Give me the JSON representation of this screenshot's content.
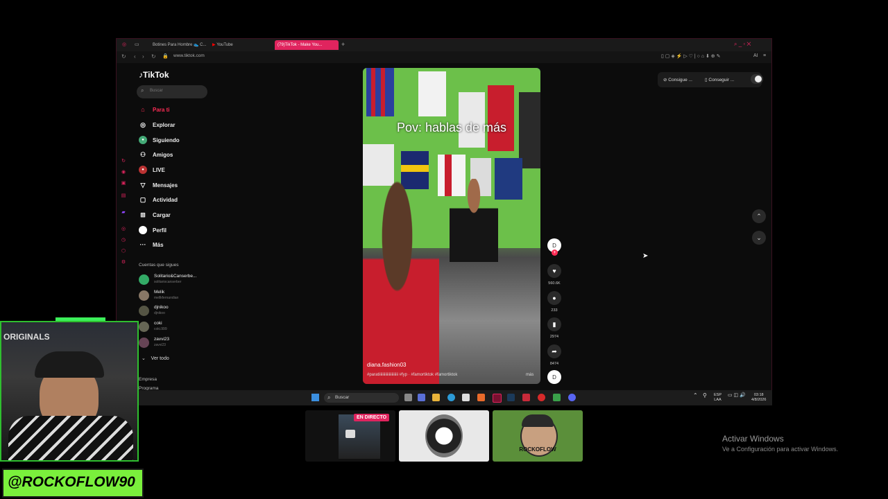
{
  "browser": {
    "tabs": [
      {
        "label": "Botines Para Hombre 👟 C..."
      },
      {
        "label": "YouTube"
      },
      {
        "label": "(79)TikTok - Make You..."
      }
    ],
    "new_tab": "+",
    "url": "www.tiktok.com",
    "toolbar_right": "AI"
  },
  "tiktok": {
    "logo": "TikTok",
    "search_placeholder": "Buscar",
    "nav": [
      {
        "label": "Para ti",
        "icon": "home-icon"
      },
      {
        "label": "Explorar",
        "icon": "compass-icon"
      },
      {
        "label": "Siguiendo",
        "icon": "following-avatar-icon"
      },
      {
        "label": "Amigos",
        "icon": "friends-icon"
      },
      {
        "label": "LIVE",
        "icon": "live-icon"
      },
      {
        "label": "Mensajes",
        "icon": "message-icon"
      },
      {
        "label": "Actividad",
        "icon": "activity-icon"
      },
      {
        "label": "Cargar",
        "icon": "upload-icon"
      },
      {
        "label": "Perfil",
        "icon": "profile-icon"
      },
      {
        "label": "Más",
        "icon": "more-icon"
      }
    ],
    "following_title": "Cuentas que sigues",
    "following": [
      {
        "name": "Solitario&Canserbe...",
        "handle": "solitariocanserber"
      },
      {
        "name": "Melik",
        "handle": "mellkfernandian"
      },
      {
        "name": "djnikoo",
        "handle": "djnikoo"
      },
      {
        "name": "coki",
        "handle": "coki.999"
      },
      {
        "name": "zavvi23",
        "handle": "zavvi23"
      }
    ],
    "see_all": "Ver todo",
    "footer_links": [
      "Empresa",
      "Programa"
    ],
    "video": {
      "caption": "Pov: hablas de más",
      "username": "diana.fashion03",
      "hashtags": "#paratiiiiiiiiiiiiiiiiiiiii #fyp · #famortiktok #famortiktok",
      "more": "más"
    },
    "actions": {
      "likes": "560.6K",
      "comments": "233",
      "saves": "2974",
      "shares": "8474"
    },
    "top_right": {
      "get_app1": "Consigue ...",
      "get_app2": "Conseguir ..."
    }
  },
  "taskbar": {
    "search_label": "Buscar",
    "lang_top": "ESP",
    "lang_bottom": "LAA",
    "time": "03:18",
    "date": "4/8/2026"
  },
  "stream": {
    "webcam_label": "ORIGINALS",
    "handle": "@ROCKOFLOW90",
    "live_badge": "EN DIRECTO",
    "thumb3_label": "ROCKOFLOW"
  },
  "windows_watermark": {
    "line1": "Activar Windows",
    "line2": "Ve a Configuración para activar Windows."
  },
  "colors": {
    "tiktok_accent": "#fe2c55",
    "browser_accent": "#e0245e",
    "overlay_green": "#7af03c"
  }
}
